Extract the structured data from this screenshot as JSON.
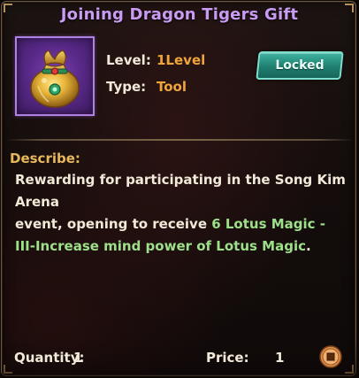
{
  "item": {
    "title": "Joining Dragon Tigers Gift",
    "icon": "gold-treasure-bag-icon",
    "level_label": "Level:",
    "level_value": "1Level",
    "type_label": "Type:",
    "type_value": "Tool",
    "status_badge": "Locked"
  },
  "description": {
    "heading": "Describe:",
    "line1": "Rewarding for participating in the Song Kim Arena",
    "line2_prefix": "event, opening to receive ",
    "line2_highlight": "6 Lotus Magic -",
    "line3_highlight": "III-Increase mind power of Lotus Magic",
    "line3_suffix": "."
  },
  "footer": {
    "quantity_label": "Quantity:",
    "quantity_value": "1",
    "price_label": "Price:",
    "price_value": "1",
    "currency_icon": "copper-coin-icon"
  },
  "colors": {
    "title": "#c99bf2",
    "stat_value": "#f0a53a",
    "heading": "#e8b85c",
    "highlight": "#9ee08a",
    "badge": "#2a9a88"
  }
}
